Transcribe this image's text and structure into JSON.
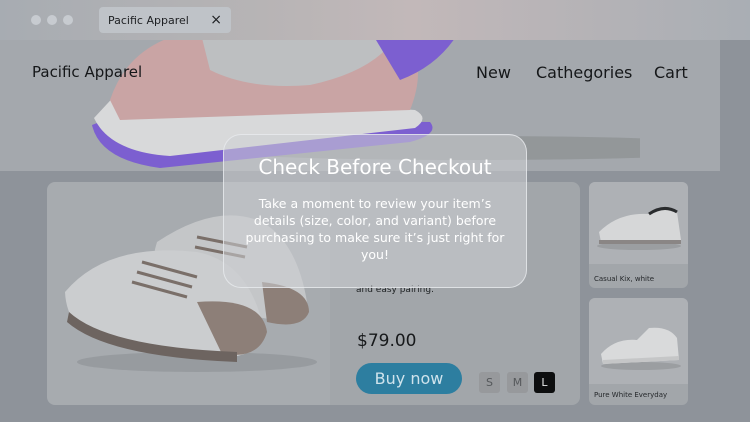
{
  "browser": {
    "tab_title": "Pacific Apparel",
    "close_symbol": "×"
  },
  "header": {
    "brand": "Pacific Apparel",
    "nav": [
      "New",
      "Cathegories",
      "Cart"
    ]
  },
  "product": {
    "description_tail": "and easy pairing.",
    "price": "$79.00",
    "buy_label": "Buy now",
    "sizes": [
      "S",
      "M",
      "L"
    ],
    "selected_size": "L"
  },
  "recommendations": [
    {
      "caption": "Casual Kix, white"
    },
    {
      "caption": "Pure White Everyday"
    }
  ],
  "modal": {
    "title": "Check Before Checkout",
    "body": "Take a moment to review your item’s details (size, color, and variant) before purchasing to make sure it’s just right for you!"
  },
  "colors": {
    "accent_button": "#2d7ea0",
    "selected_size_bg": "#0d0e0f",
    "shoe_sole_purple": "#7c5fd0"
  }
}
